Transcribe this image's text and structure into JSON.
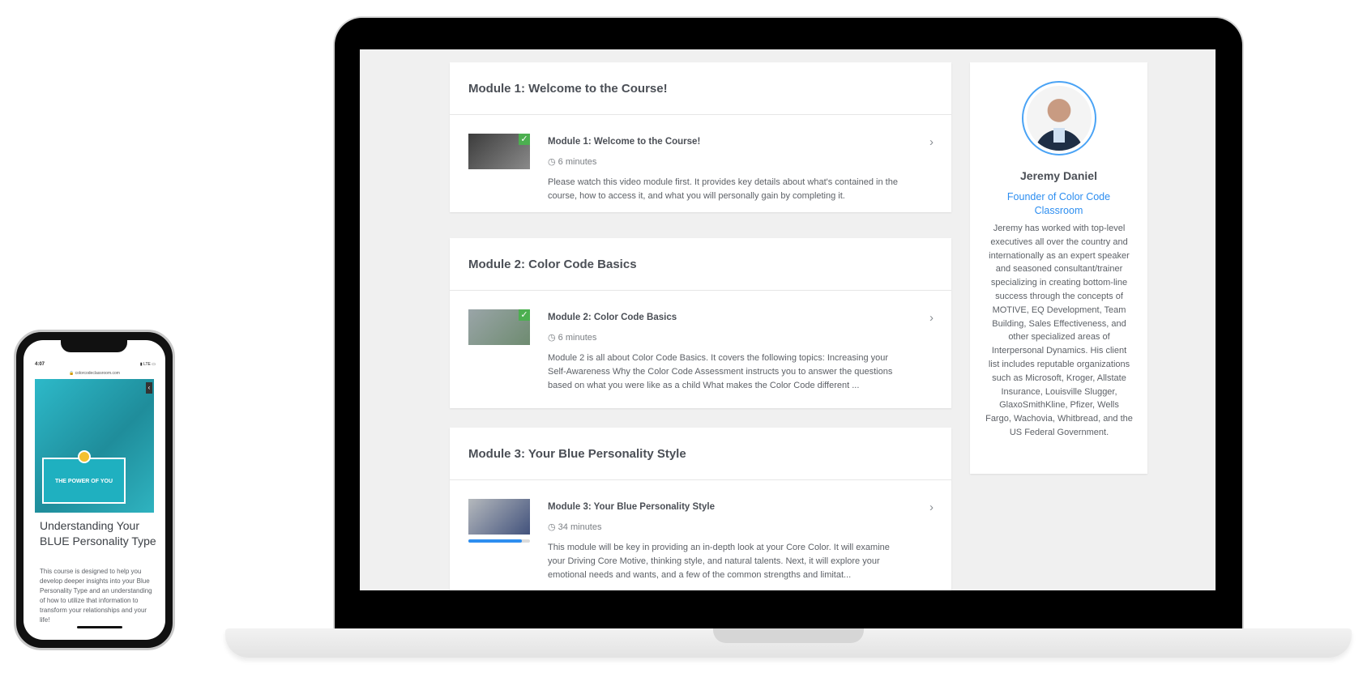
{
  "modules": [
    {
      "title": "Module 1: Welcome to the Course!",
      "lesson": {
        "title": "Module 1: Welcome to the Course!",
        "duration": "6 minutes",
        "description": "Please watch this video module first. It provides key details about what's contained in the course, how to access it, and what you will personally gain by completing it.",
        "completed": true
      }
    },
    {
      "title": "Module 2: Color Code Basics",
      "lesson": {
        "title": "Module 2: Color Code Basics",
        "duration": "6 minutes",
        "description": "Module 2 is all about Color Code Basics. It covers the following topics: Increasing your Self-Awareness Why the Color Code Assessment instructs you to answer the questions based on what you were like as a child What makes the Color Code different ...",
        "completed": true
      }
    },
    {
      "title": "Module 3: Your Blue Personality Style",
      "lesson": {
        "title": "Module 3: Your Blue Personality Style",
        "duration": "34 minutes",
        "description": "This module will be key in providing an in-depth look at your Core Color. It will examine your Driving Core Motive, thinking style, and natural talents. Next, it will explore your emotional needs and wants, and a few of the common strengths and limitat...",
        "completed": false,
        "progress_fraction": 0.87
      }
    }
  ],
  "instructor": {
    "name": "Jeremy Daniel",
    "role": "Founder of Color Code Classroom",
    "bio": "Jeremy has worked with top-level executives all over the country and internationally as an expert speaker and seasoned consultant/trainer specializing in creating bottom-line success through the concepts of MOTIVE, EQ Development, Team Building, Sales Effectiveness, and other specialized areas of Interpersonal Dynamics. His client list includes reputable organizations such as Microsoft, Kroger, Allstate Insurance, Louisville Slugger, GlaxoSmithKline, Pfizer, Wells Fargo, Wachovia, Whitbread, and the US Federal Government."
  },
  "phone": {
    "time": "4:07",
    "status": "LTE",
    "url": "colorcodeclassroom.com",
    "hero_text": "THE POWER OF YOU",
    "course_title": "Understanding Your BLUE Personality Type",
    "course_description": "This course is designed to help you develop deeper insights into your Blue Personality Type and an understanding of how to utilize that information to transform your relationships and your life!"
  },
  "colors": {
    "accent": "#2d8ef0",
    "check": "#4caf50",
    "hero": "#1fb0c0"
  }
}
